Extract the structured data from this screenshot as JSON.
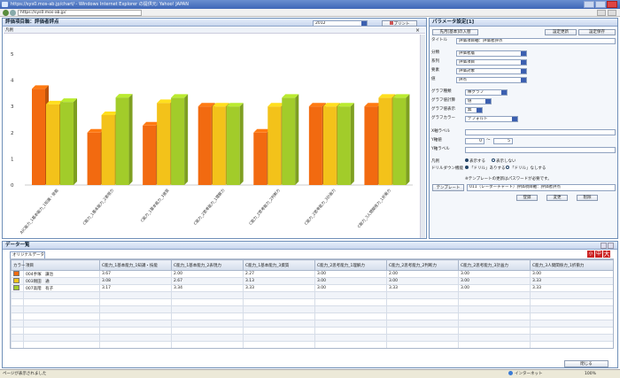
{
  "browser": {
    "title": "https://sys0.mos-ab.jp/chart/ - Windows Internet Explorer の提供元: Yahoo! JAPAN",
    "url": "https://sys0.mos-ab.jp/"
  },
  "chart_panel": {
    "title": "評価項目軸：評価者評点",
    "year_select": "2012",
    "print_label": "プリント",
    "legend_tab": "凡例",
    "close_x": "×"
  },
  "chart_data": {
    "type": "bar",
    "categories": [
      "A)C能力_1基本能力_1知識・技能",
      "C能力_1基本能力_2表現力",
      "C能力_1基本能力_3資質",
      "C能力_2思考能力_1理解力",
      "C能力_2思考能力_2判断力",
      "C能力_2思考能力_3計画力",
      "C能力_3人間関係力_1折衝力"
    ],
    "series": [
      {
        "values": [
          3.67,
          2.0,
          2.27,
          3.0,
          2.0,
          3.0,
          3.0
        ],
        "color": "#f26a10"
      },
      {
        "values": [
          3.08,
          2.67,
          3.13,
          3.0,
          3.0,
          3.0,
          3.33
        ],
        "color": "#f3c21a"
      },
      {
        "values": [
          3.17,
          3.34,
          3.33,
          3.0,
          3.33,
          3.0,
          3.33
        ],
        "color": "#a2cc2a"
      }
    ],
    "ylim": [
      0,
      5
    ],
    "yticks": [
      "0",
      "1",
      "2",
      "3",
      "4",
      "5"
    ],
    "grid": false
  },
  "settings_panel": {
    "title": "パラメータ設定[1]",
    "load_button": "先月[基本]の入替",
    "set_button": "設定更新",
    "save_button": "設定保存",
    "rows": [
      {
        "label": "タイトル",
        "value": "評価項目軸：評価者評点",
        "type": "text"
      },
      {
        "label": "分類",
        "value": "評価者層",
        "type": "select"
      },
      {
        "label": "系列",
        "value": "評価項目",
        "type": "select"
      },
      {
        "label": "要素",
        "value": "評価対象",
        "type": "select"
      },
      {
        "label": "値",
        "value": "評点",
        "type": "select"
      }
    ],
    "graph_type_label": "グラフ種類",
    "graph_type_value": "棒グラフ",
    "graph_calc_label": "グラフ値計算",
    "graph_calc_value": "値",
    "graph_disp_label": "グラフ値表示",
    "graph_disp_value": "無",
    "graph_color_label": "グラフカラー",
    "graph_color_value": "デフォルト",
    "xlabel_label": "X軸ラベル",
    "xlabel_value": "",
    "yrange_label": "Y軸値",
    "yrange_min": "0",
    "yrange_sep": "〜",
    "yrange_max": "5",
    "ylabel_label": "Y軸ラベル",
    "legend_label": "凡例",
    "legend_show": "表示する",
    "legend_hide": "表示しない",
    "drill_label": "ドリルダウン機能",
    "drill_on": "「ドリル」ありする",
    "drill_off": "「ドリル」なしする",
    "template_note": "※テンプレートの更新はパスワードが必要です。",
    "template_button": "テンプレート",
    "template_value": "011（レーダーチャート）評価項目軸：評価者評点",
    "btn_update": "登録",
    "btn_change": "変更",
    "btn_delete": "削除"
  },
  "data_panel": {
    "title": "データ一覧",
    "tab": "オリジナルデータ",
    "font_small": "小",
    "font_mid": "中",
    "font_large": "大",
    "columns": [
      "カラー",
      "項目",
      "C能力_1基本能力_1知識・技能",
      "C能力_1基本能力_2表現力",
      "C能力_1基本能力_3資質",
      "C能力_2思考能力_1理解力",
      "C能力_2思考能力_2判断力",
      "C能力_2思考能力_3計画力",
      "C能力_3人間関係力_1折衝力"
    ],
    "rows": [
      {
        "color": "#f26a10",
        "item": "004手塚　謙治",
        "values": [
          "3.67",
          "2.00",
          "2.27",
          "3.00",
          "2.00",
          "3.00",
          "3.00"
        ]
      },
      {
        "color": "#f3c21a",
        "item": "003剛田　通",
        "values": [
          "3.08",
          "2.67",
          "3.13",
          "3.00",
          "3.00",
          "3.00",
          "3.33"
        ]
      },
      {
        "color": "#a2cc2a",
        "item": "007高階　有子",
        "values": [
          "3.17",
          "3.34",
          "3.33",
          "3.00",
          "3.33",
          "3.00",
          "3.33"
        ]
      }
    ],
    "close_button": "閉じる"
  },
  "statusbar": {
    "text": "ページが表示されました",
    "zone": "インターネット",
    "zoom": "100%"
  }
}
